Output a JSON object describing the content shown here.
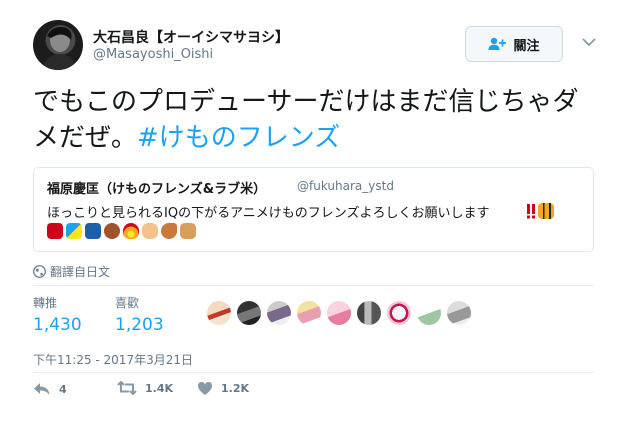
{
  "author": {
    "display_name": "大石昌良【オーイシマサヨシ】",
    "screen_name": "@Masayoshi_Oishi"
  },
  "follow_button": {
    "label": "關注"
  },
  "tweet": {
    "text_part1": "でもこのプロデューサーだけはまだ信じちゃダメだぜ。",
    "hashtag": "#けものフレンズ"
  },
  "quote": {
    "name": "福原慶匡（けものフレンズ&ラブ米）",
    "handle": "@fukuhara_ystd",
    "text": "ほっこりと見られるIQの下がるアニメけものフレンズよろしくお願いします"
  },
  "translate": {
    "label": "翻譯自日文"
  },
  "stats": {
    "retweets_label": "轉推",
    "retweets_value": "1,430",
    "likes_label": "喜歡",
    "likes_value": "1,203"
  },
  "timestamp": "下午11:25 - 2017年3月21日",
  "actions": {
    "reply_count": "4",
    "retweet_count": "1.4K",
    "like_count": "1.2K"
  },
  "icons": {
    "follow": "add-user-icon",
    "caret": "chevron-down-icon",
    "translate": "globe-icon",
    "reply": "reply-icon",
    "retweet": "retweet-icon",
    "like": "heart-icon"
  },
  "colors": {
    "accent": "#1da1f2",
    "secondary_text": "#657786",
    "border": "#e1e8ed"
  }
}
